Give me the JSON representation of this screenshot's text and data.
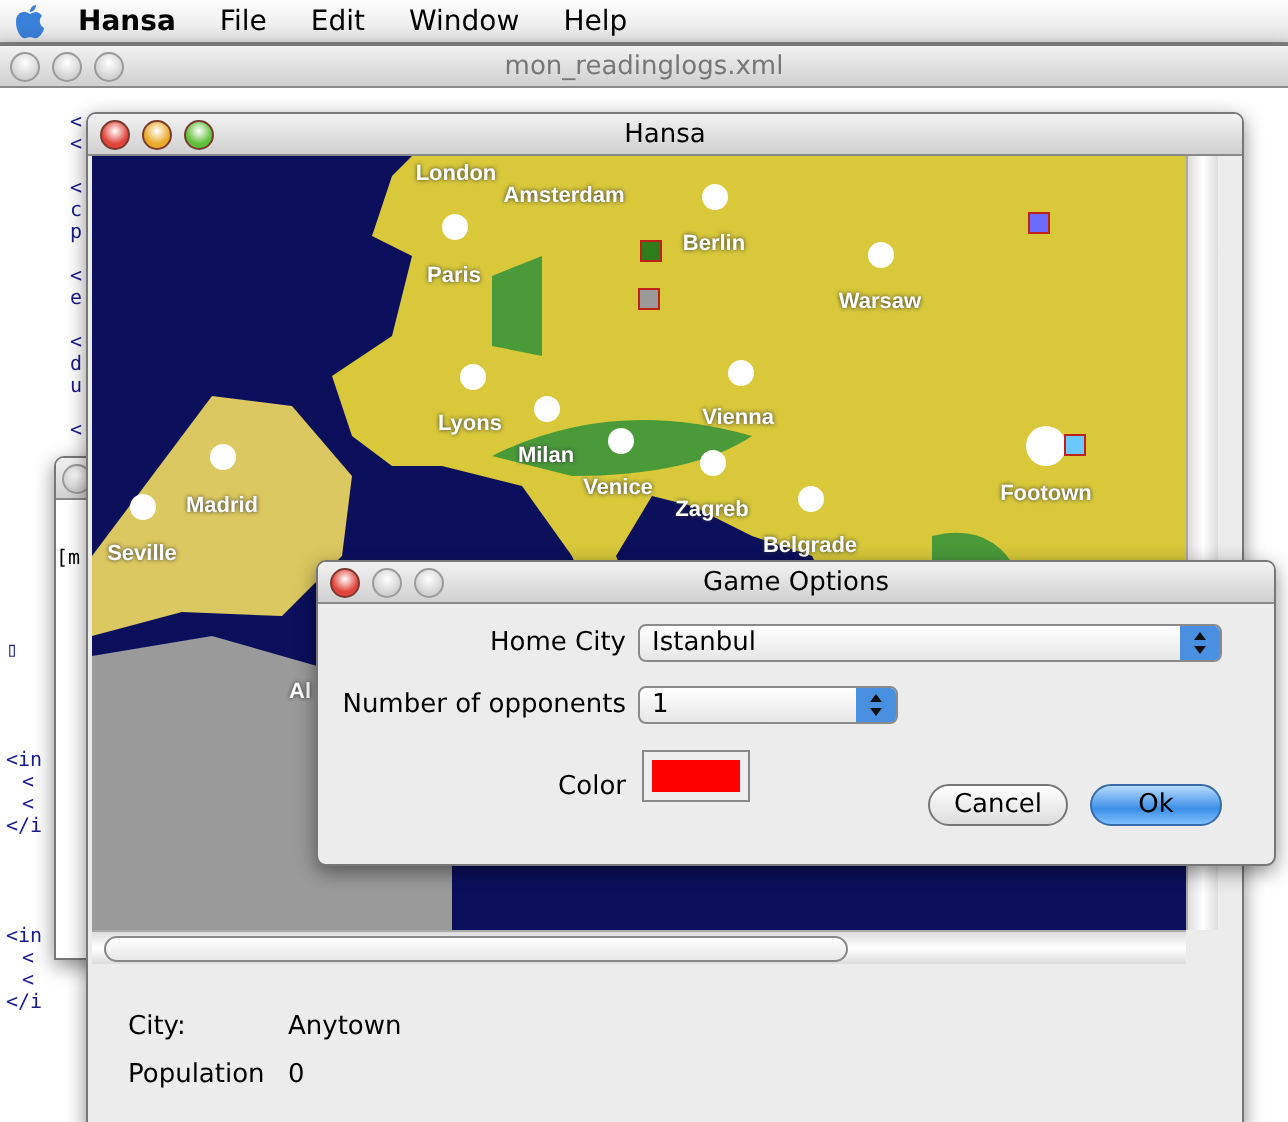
{
  "menu_bar": {
    "app": "Hansa",
    "items": [
      "File",
      "Edit",
      "Window",
      "Help"
    ]
  },
  "editor_window": {
    "title": "mon_readinglogs.xml",
    "active": false,
    "column_groups": [
      [
        "<",
        "<"
      ],
      [
        "<",
        "c",
        "p"
      ],
      [
        "<",
        "e"
      ],
      [
        "<",
        "d",
        "u"
      ],
      [
        "<"
      ]
    ],
    "left_groups": [
      [
        "▯"
      ],
      [
        "<in",
        "<",
        "<",
        "</i"
      ],
      [
        "<in",
        "<",
        "<",
        "</i"
      ]
    ]
  },
  "back_window": {
    "active": false,
    "text": "[m"
  },
  "hansa_window": {
    "title": "Hansa",
    "active": true,
    "map": {
      "cities": [
        {
          "name": "London"
        },
        {
          "name": "Amsterdam"
        },
        {
          "name": "Paris"
        },
        {
          "name": "Berlin"
        },
        {
          "name": "Warsaw"
        },
        {
          "name": "Lyons"
        },
        {
          "name": "Milan"
        },
        {
          "name": "Vienna"
        },
        {
          "name": "Venice"
        },
        {
          "name": "Zagreb"
        },
        {
          "name": "Belgrade"
        },
        {
          "name": "Footown"
        },
        {
          "name": "Madrid"
        },
        {
          "name": "Seville"
        },
        {
          "name": "Al"
        }
      ],
      "markers": [
        {
          "color": "#2e7d1a"
        },
        {
          "color": "#9a9a9a"
        },
        {
          "color": "#6a6aff"
        },
        {
          "color": "#6ac8ff"
        }
      ]
    },
    "info": [
      {
        "label": "City:",
        "value": "Anytown"
      },
      {
        "label": "Population",
        "value": "0"
      }
    ]
  },
  "dialog": {
    "title": "Game Options",
    "active": true,
    "home_city": {
      "label": "Home City",
      "value": "Istanbul"
    },
    "opponents": {
      "label": "Number of opponents",
      "value": "1"
    },
    "color": {
      "label": "Color",
      "color": "#ff0000"
    },
    "buttons": [
      {
        "label": "Cancel",
        "default": false
      },
      {
        "label": "Ok",
        "default": true
      }
    ]
  }
}
